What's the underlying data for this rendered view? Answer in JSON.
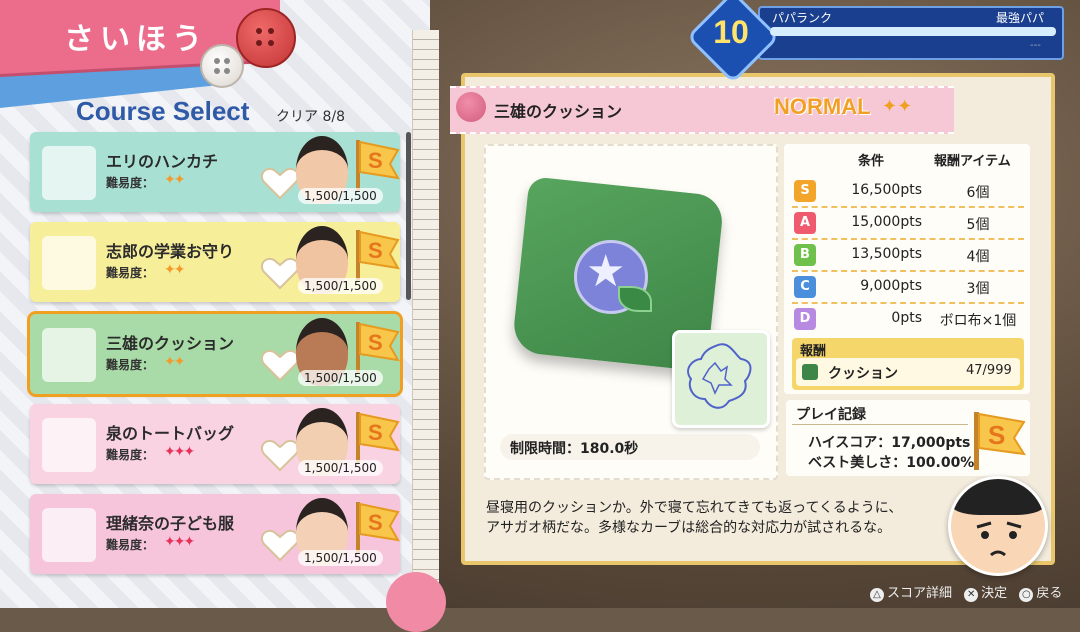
{
  "screen_title": "さいほう",
  "course_select_label": "Course Select",
  "clear_count": "クリア 8/8",
  "difficulty_label": "難易度：",
  "courses": [
    {
      "name": "エリのハンカチ",
      "stars": "✦✦",
      "star_color": "#f39a2a",
      "score": "1,500/1,500",
      "bg": "#a8e0d4",
      "thumb": "handkerchief-icon"
    },
    {
      "name": "志郎の学業お守り",
      "stars": "✦✦",
      "star_color": "#f39a2a",
      "score": "1,500/1,500",
      "bg": "#f7ee9a",
      "thumb": "charm-icon"
    },
    {
      "name": "三雄のクッション",
      "stars": "✦✦",
      "star_color": "#f39a2a",
      "score": "1,500/1,500",
      "bg": "#a9dba8",
      "thumb": "cushion-icon"
    },
    {
      "name": "泉のトートバッグ",
      "stars": "✦✦✦",
      "star_color": "#e8325a",
      "score": "1,500/1,500",
      "bg": "#f9d3e2",
      "thumb": "tote-bag-icon"
    },
    {
      "name": "理緒奈の子ども服",
      "stars": "✦✦✦",
      "star_color": "#e8325a",
      "score": "1,500/1,500",
      "bg": "#f6c5dc",
      "thumb": "dress-icon"
    }
  ],
  "selected_course_index": 2,
  "detail": {
    "title": "三雄のクッション",
    "difficulty": "NORMAL",
    "difficulty_stars": "✦✦",
    "time_limit": "制限時間：180.0秒",
    "table_headers": {
      "condition": "条件",
      "reward_item": "報酬アイテム"
    },
    "ranks": [
      {
        "rank": "S",
        "color": "#f3a52a",
        "pts": "16,500pts",
        "reward": "6個"
      },
      {
        "rank": "A",
        "color": "#ef5a6e",
        "pts": "15,000pts",
        "reward": "5個"
      },
      {
        "rank": "B",
        "color": "#6fc14c",
        "pts": "13,500pts",
        "reward": "4個"
      },
      {
        "rank": "C",
        "color": "#4b8fdc",
        "pts": "9,000pts",
        "reward": "3個"
      },
      {
        "rank": "D",
        "color": "#b889e0",
        "pts": "0pts",
        "reward": "ボロ布×1個"
      }
    ],
    "reward_section_label": "報酬",
    "reward_item_name": "クッション",
    "reward_item_count": "47/999",
    "record_label": "プレイ記録",
    "high_score": "ハイスコア：17,000pts",
    "best_beauty": "ベスト美しさ：100.00%",
    "description_line1": "昼寝用のクッションか。外で寝て忘れてきても返ってくるように、",
    "description_line2": "アサガオ柄だな。多様なカーブは総合的な対応力が試されるな。"
  },
  "rank": {
    "number": "10",
    "label": "パパランク",
    "title": "最強パパ",
    "progress": 1.0,
    "sub": "---"
  },
  "footer": {
    "score_detail": "スコア詳細",
    "confirm": "決定",
    "back": "戻る",
    "score_detail_icon": "triangle-button-icon",
    "confirm_icon": "cross-button-icon",
    "back_icon": "circle-button-icon"
  }
}
